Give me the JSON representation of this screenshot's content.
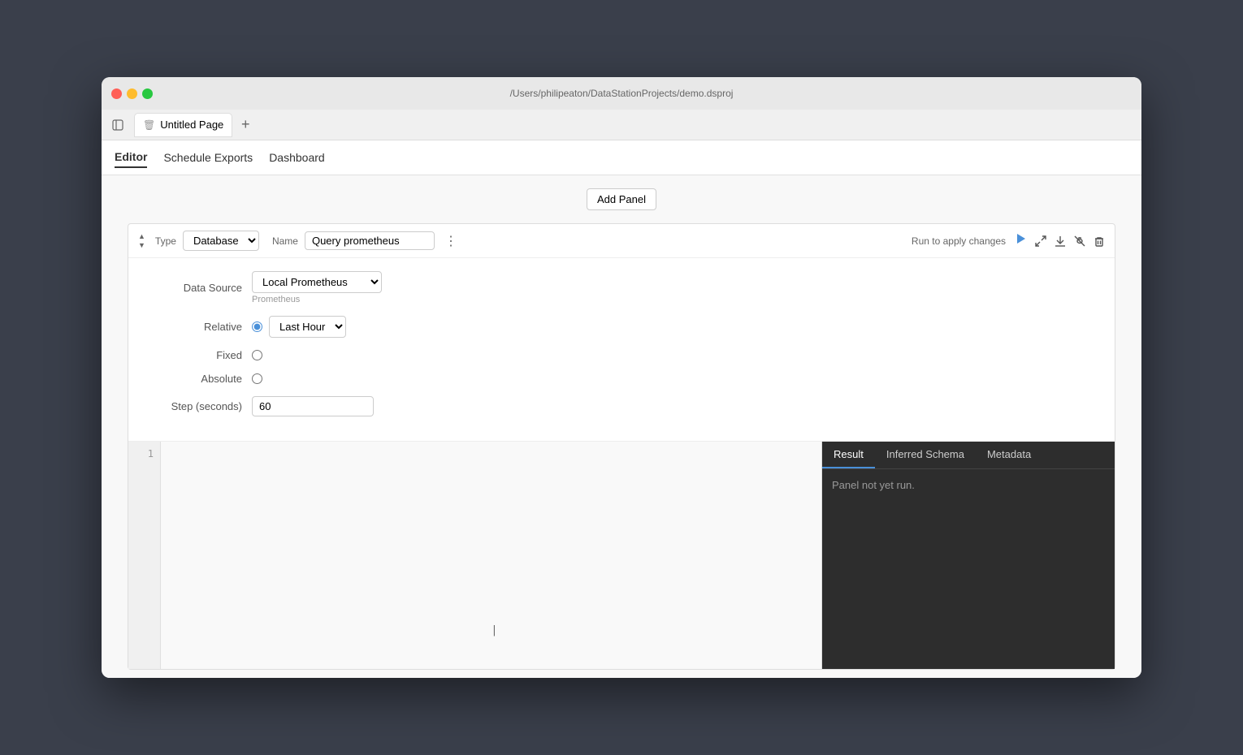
{
  "titleBar": {
    "title": "/Users/philipeaton/DataStationProjects/demo.dsproj"
  },
  "tab": {
    "label": "Untitled Page",
    "iconLabel": "trash-icon"
  },
  "addTabLabel": "+",
  "nav": {
    "items": [
      {
        "label": "Editor",
        "active": true
      },
      {
        "label": "Schedule Exports",
        "active": false
      },
      {
        "label": "Dashboard",
        "active": false
      }
    ]
  },
  "addPanelButton": "Add Panel",
  "panel": {
    "typeLabel": "Type",
    "typeValue": "Database",
    "nameLabel": "Name",
    "nameValue": "Query prometheus",
    "runToApplyLabel": "Run to apply changes",
    "dataSourceLabel": "Data Source",
    "dataSourceValue": "Local Prometheus",
    "dataSourceHint": "Prometheus",
    "relativeLabel": "Relative",
    "relativeChecked": true,
    "lastHourValue": "Last Hour",
    "fixedLabel": "Fixed",
    "fixedChecked": false,
    "absoluteLabel": "Absolute",
    "absoluteChecked": false,
    "stepLabel": "Step (seconds)",
    "stepValue": "60",
    "resultTabs": [
      {
        "label": "Result",
        "active": true
      },
      {
        "label": "Inferred Schema",
        "active": false
      },
      {
        "label": "Metadata",
        "active": false
      }
    ],
    "resultContent": "Panel not yet run."
  }
}
